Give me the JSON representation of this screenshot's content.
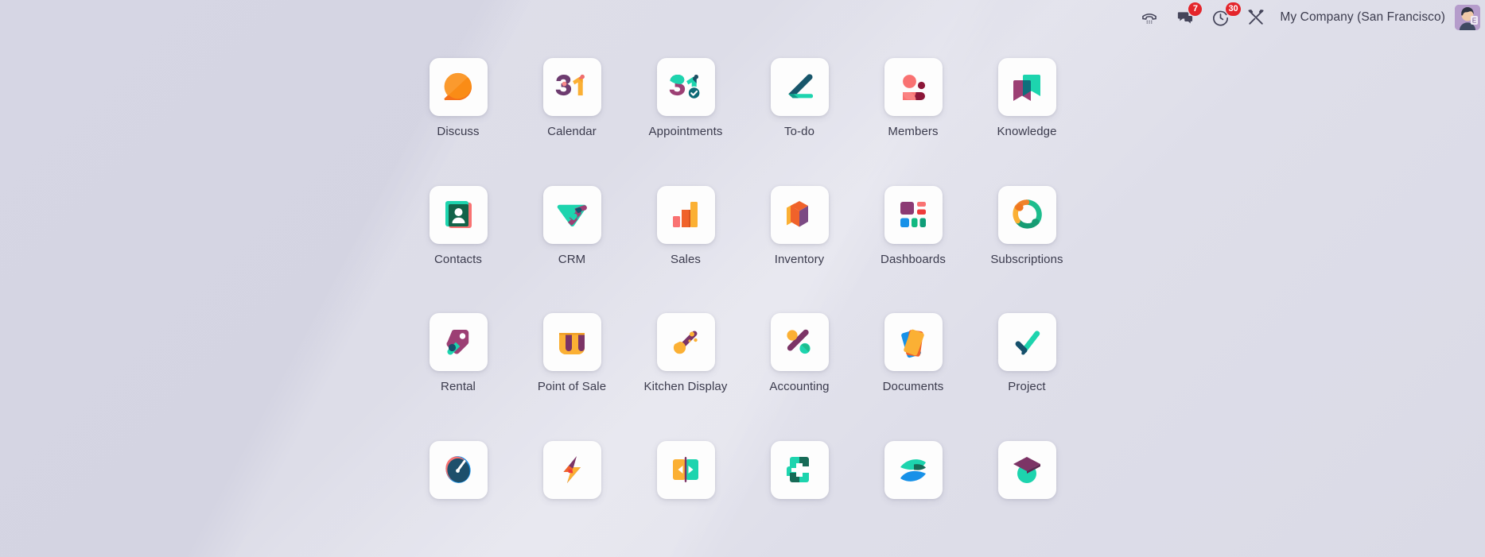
{
  "navbar": {
    "company": "My Company (San Francisco)",
    "icons": [
      {
        "name": "voip-dialpad-icon",
        "label": "VoIP"
      },
      {
        "name": "messages-icon",
        "label": "Messages",
        "badge": "7"
      },
      {
        "name": "activities-clock-icon",
        "label": "Activities",
        "badge": "30"
      },
      {
        "name": "settings-tools-icon",
        "label": "Settings"
      }
    ],
    "badge_color": "#e4252b",
    "avatar_alt": "User avatar"
  },
  "apps": [
    {
      "id": "discuss",
      "label": "Discuss"
    },
    {
      "id": "calendar",
      "label": "Calendar"
    },
    {
      "id": "appointments",
      "label": "Appointments"
    },
    {
      "id": "todo",
      "label": "To-do"
    },
    {
      "id": "members",
      "label": "Members"
    },
    {
      "id": "knowledge",
      "label": "Knowledge"
    },
    {
      "id": "contacts",
      "label": "Contacts"
    },
    {
      "id": "crm",
      "label": "CRM"
    },
    {
      "id": "sales",
      "label": "Sales"
    },
    {
      "id": "inventory",
      "label": "Inventory"
    },
    {
      "id": "dashboards",
      "label": "Dashboards"
    },
    {
      "id": "subscriptions",
      "label": "Subscriptions"
    },
    {
      "id": "rental",
      "label": "Rental"
    },
    {
      "id": "pos",
      "label": "Point of Sale"
    },
    {
      "id": "kitchen",
      "label": "Kitchen Display"
    },
    {
      "id": "accounting",
      "label": "Accounting"
    },
    {
      "id": "documents",
      "label": "Documents"
    },
    {
      "id": "project",
      "label": "Project"
    },
    {
      "id": "row4a",
      "label": ""
    },
    {
      "id": "row4b",
      "label": ""
    },
    {
      "id": "row4c",
      "label": ""
    },
    {
      "id": "row4d",
      "label": ""
    },
    {
      "id": "row4e",
      "label": ""
    },
    {
      "id": "row4f",
      "label": ""
    }
  ],
  "theme": {
    "page_bg_start": "#d6d6e4",
    "page_bg_end": "#d8d8e5",
    "tile_bg": "#fdfdfd",
    "label_color": "#3b3b4d"
  }
}
